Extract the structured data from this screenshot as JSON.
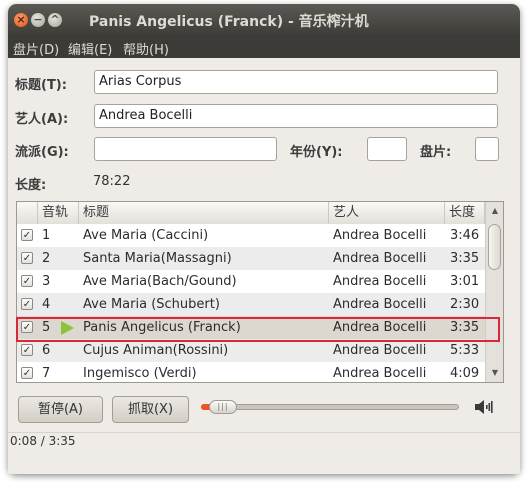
{
  "window": {
    "title": "Panis Angelicus (Franck) - 音乐榨汁机"
  },
  "menu": [
    {
      "label": "盘片(D)"
    },
    {
      "label": "编辑(E)"
    },
    {
      "label": "帮助(H)"
    }
  ],
  "form": {
    "title_label": "标题(T):",
    "title_value": "Arias Corpus",
    "artist_label": "艺人(A):",
    "artist_value": "Andrea Bocelli",
    "genre_label": "流派(G):",
    "genre_value": "",
    "year_label": "年份(Y):",
    "year_value": "",
    "disc_label": "盘片:",
    "disc_value": "",
    "duration_label": "长度:",
    "duration_value": "78:22"
  },
  "tracklist": {
    "headers": {
      "track": "音轨",
      "title": "标题",
      "artist": "艺人",
      "length": "长度"
    },
    "rows": [
      {
        "checked": true,
        "track": "1",
        "title": "Ave Maria (Caccini)",
        "artist": "Andrea Bocelli",
        "length": "3:46",
        "playing": false
      },
      {
        "checked": true,
        "track": "2",
        "title": "Santa Maria(Massagni)",
        "artist": "Andrea Bocelli",
        "length": "3:35",
        "playing": false
      },
      {
        "checked": true,
        "track": "3",
        "title": "Ave Maria(Bach/Gound)",
        "artist": "Andrea Bocelli",
        "length": "3:01",
        "playing": false
      },
      {
        "checked": true,
        "track": "4",
        "title": "Ave Maria (Schubert)",
        "artist": "Andrea Bocelli",
        "length": "2:30",
        "playing": false
      },
      {
        "checked": true,
        "track": "5",
        "title": "Panis Angelicus (Franck)",
        "artist": "Andrea Bocelli",
        "length": "3:35",
        "playing": true
      },
      {
        "checked": true,
        "track": "6",
        "title": "Cujus Animan(Rossini)",
        "artist": "Andrea Bocelli",
        "length": "5:33",
        "playing": false
      },
      {
        "checked": true,
        "track": "7",
        "title": "Ingemisco (Verdi)",
        "artist": "Andrea Bocelli",
        "length": "4:09",
        "playing": false
      }
    ]
  },
  "controls": {
    "pause_label": "暂停(A)",
    "extract_label": "抓取(X)",
    "progress_fraction": 0.04,
    "volume_icon": "speaker-icon"
  },
  "status": {
    "time": "0:08 / 3:35"
  },
  "colors": {
    "highlight_border": "#d8283a",
    "progress_fill": "#e8552a",
    "play_indicator": "#8fc23c",
    "titlebar": "#3c3b37"
  }
}
